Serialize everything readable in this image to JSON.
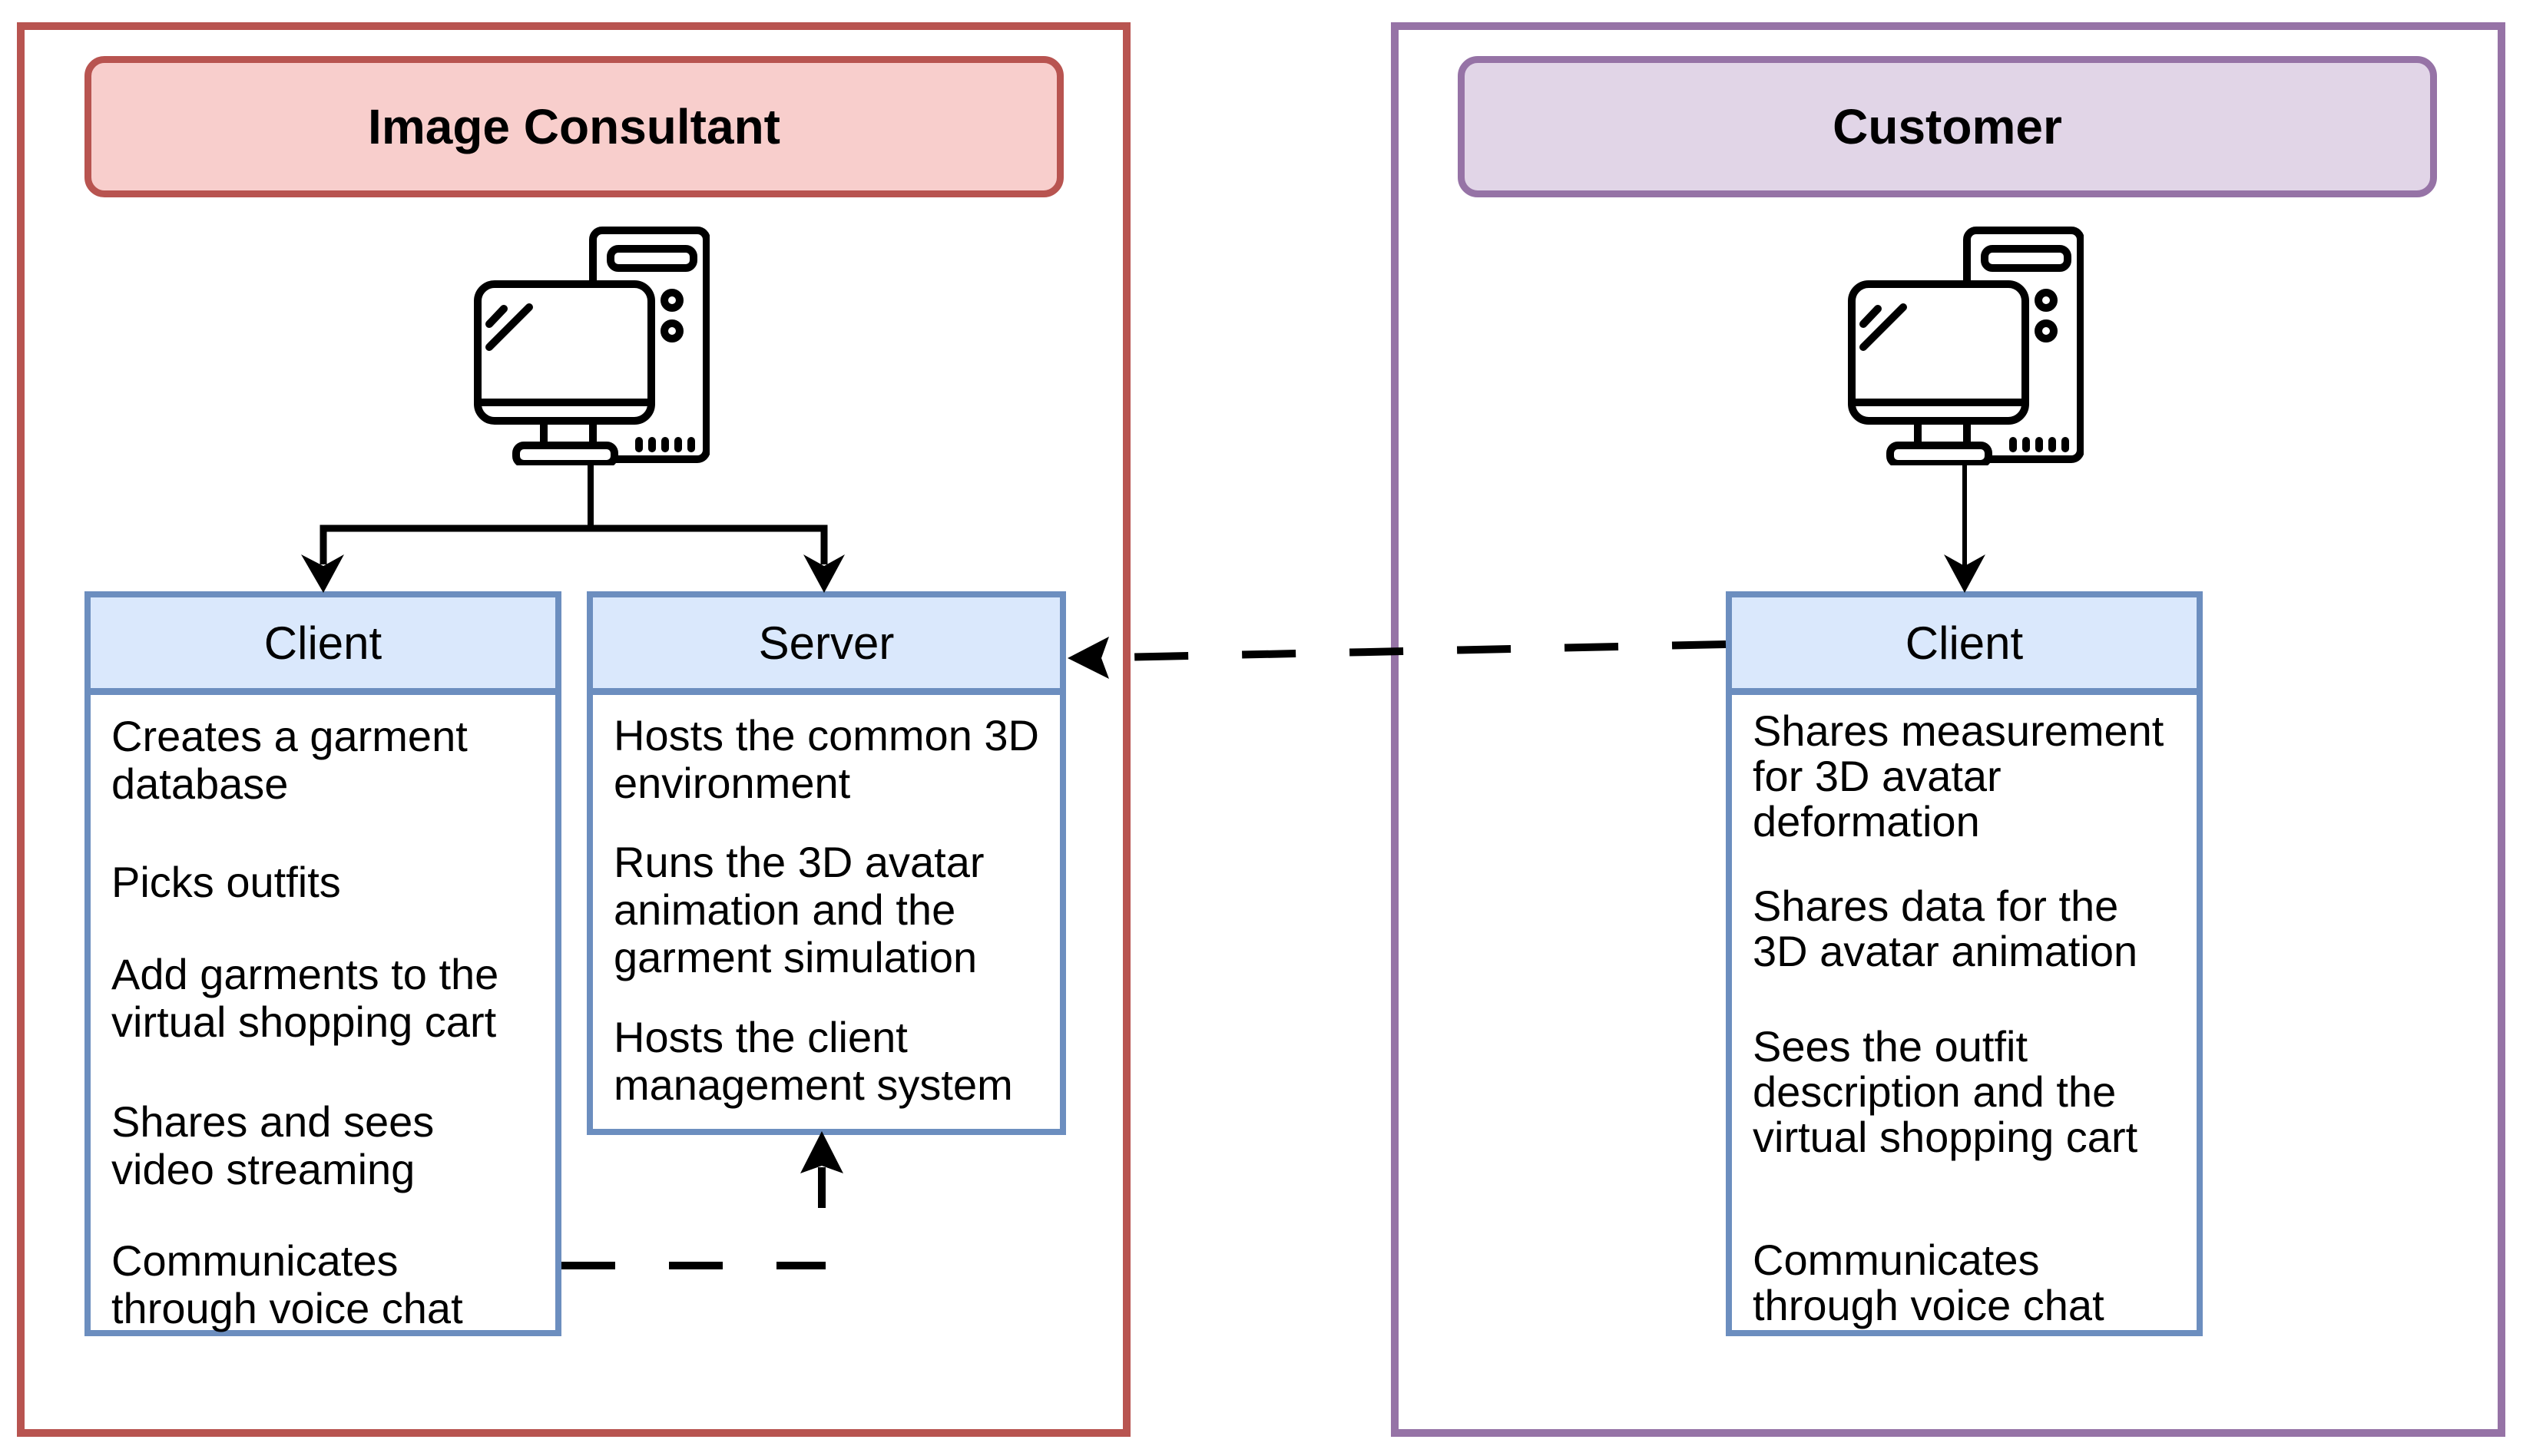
{
  "colors": {
    "consultant_border": "#B85450",
    "consultant_fill": "#F8CECC",
    "customer_border": "#9673A6",
    "customer_fill": "#E1D5E7",
    "box_border": "#6C8EBF",
    "box_header_fill": "#DAE8FC"
  },
  "consultant": {
    "title": "Image Consultant",
    "icon": "desktop-computer-icon",
    "client": {
      "header": "Client",
      "items": [
        "Creates a garment\ndatabase",
        "Picks outfits",
        "Add garments to the\nvirtual shopping cart",
        "Shares and sees\nvideo streaming",
        "Communicates\nthrough voice chat"
      ]
    },
    "server": {
      "header": "Server",
      "items": [
        "Hosts the common 3D\nenvironment",
        "Runs the 3D avatar\nanimation and the\ngarment simulation",
        "Hosts the client\nmanagement system"
      ]
    }
  },
  "customer": {
    "title": "Customer",
    "icon": "desktop-computer-icon",
    "client": {
      "header": "Client",
      "items": [
        "Shares measurement\nfor 3D avatar\ndeformation",
        "Shares data for the\n3D avatar animation",
        "Sees the outfit\ndescription and the\nvirtual shopping cart",
        "Communicates\nthrough voice chat"
      ]
    }
  },
  "connections": [
    {
      "from": "consultant.computer",
      "to": "consultant.client",
      "style": "solid",
      "arrow": "end"
    },
    {
      "from": "consultant.computer",
      "to": "consultant.server",
      "style": "solid",
      "arrow": "end"
    },
    {
      "from": "consultant.client",
      "to": "consultant.server",
      "style": "dashed",
      "arrow": "end"
    },
    {
      "from": "customer.computer",
      "to": "customer.client",
      "style": "solid",
      "arrow": "end"
    },
    {
      "from": "customer.client",
      "to": "consultant.server",
      "style": "dashed",
      "arrow": "end"
    }
  ]
}
